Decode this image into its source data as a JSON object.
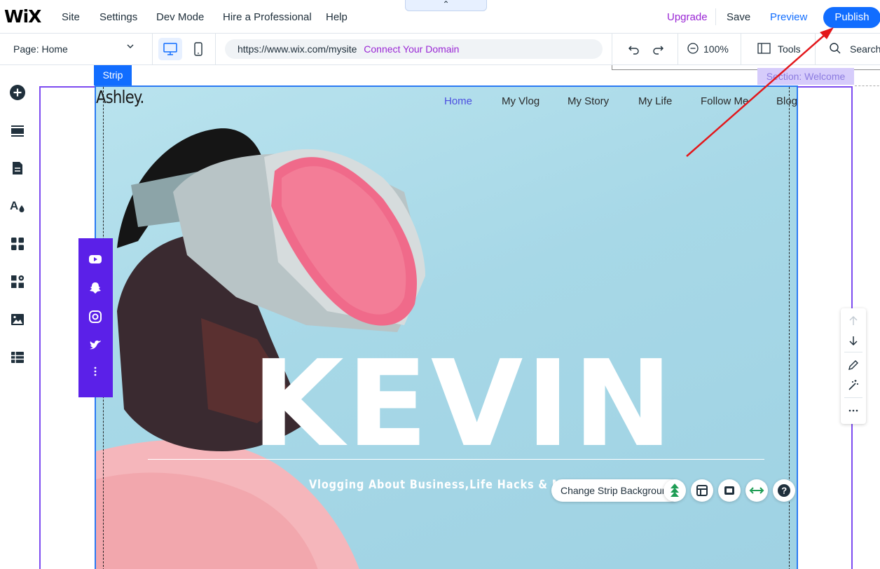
{
  "topbar": {
    "logo": "WiX",
    "menu": [
      "Site",
      "Settings",
      "Dev Mode",
      "Hire a Professional",
      "Help"
    ],
    "collapse": "⌃",
    "upgrade": "Upgrade",
    "save": "Save",
    "preview": "Preview",
    "publish": "Publish"
  },
  "secondbar": {
    "page_label": "Page:",
    "page_value": "Home",
    "url": "https://www.wix.com/mysite",
    "connect_domain": "Connect Your Domain",
    "zoom": "100%",
    "tools": "Tools",
    "search": "Search"
  },
  "canvas": {
    "strip_tag": "Strip",
    "section_tag": "Section: Welcome"
  },
  "site": {
    "name": "Ashley.",
    "nav": [
      "Home",
      "My Vlog",
      "My Story",
      "My Life",
      "Follow Me",
      "Blog"
    ],
    "hero_title": "KEVIN",
    "tagline": "Vlogging About Business,Life Hacks & My Life!"
  },
  "strip_toolbar": {
    "change_bg": "Change Strip Background"
  },
  "colors": {
    "accent": "#116dff",
    "purple": "#9a27d5",
    "section_outline": "#7d4bf0",
    "social_bar": "#5b20e8"
  }
}
